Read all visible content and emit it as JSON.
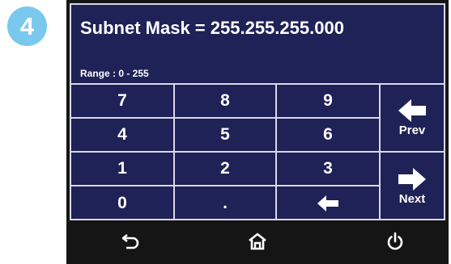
{
  "step_badge": "4",
  "header": {
    "title": "Subnet Mask = 255.255.255.000",
    "range": "Range : 0 - 255"
  },
  "keypad": {
    "keys": [
      "7",
      "8",
      "9",
      "4",
      "5",
      "6",
      "1",
      "2",
      "3",
      "0",
      "."
    ]
  },
  "nav": {
    "prev_label": "Prev",
    "next_label": "Next"
  },
  "icons": {
    "backspace": "left-arrow-icon",
    "prev": "left-arrow-icon",
    "next": "right-arrow-icon",
    "back": "back-icon",
    "home": "home-icon",
    "power": "power-icon"
  },
  "colors": {
    "screen_bg": "#1f2256",
    "badge": "#79c8ee",
    "bezel": "#151515",
    "grid": "#d8d8ea"
  }
}
